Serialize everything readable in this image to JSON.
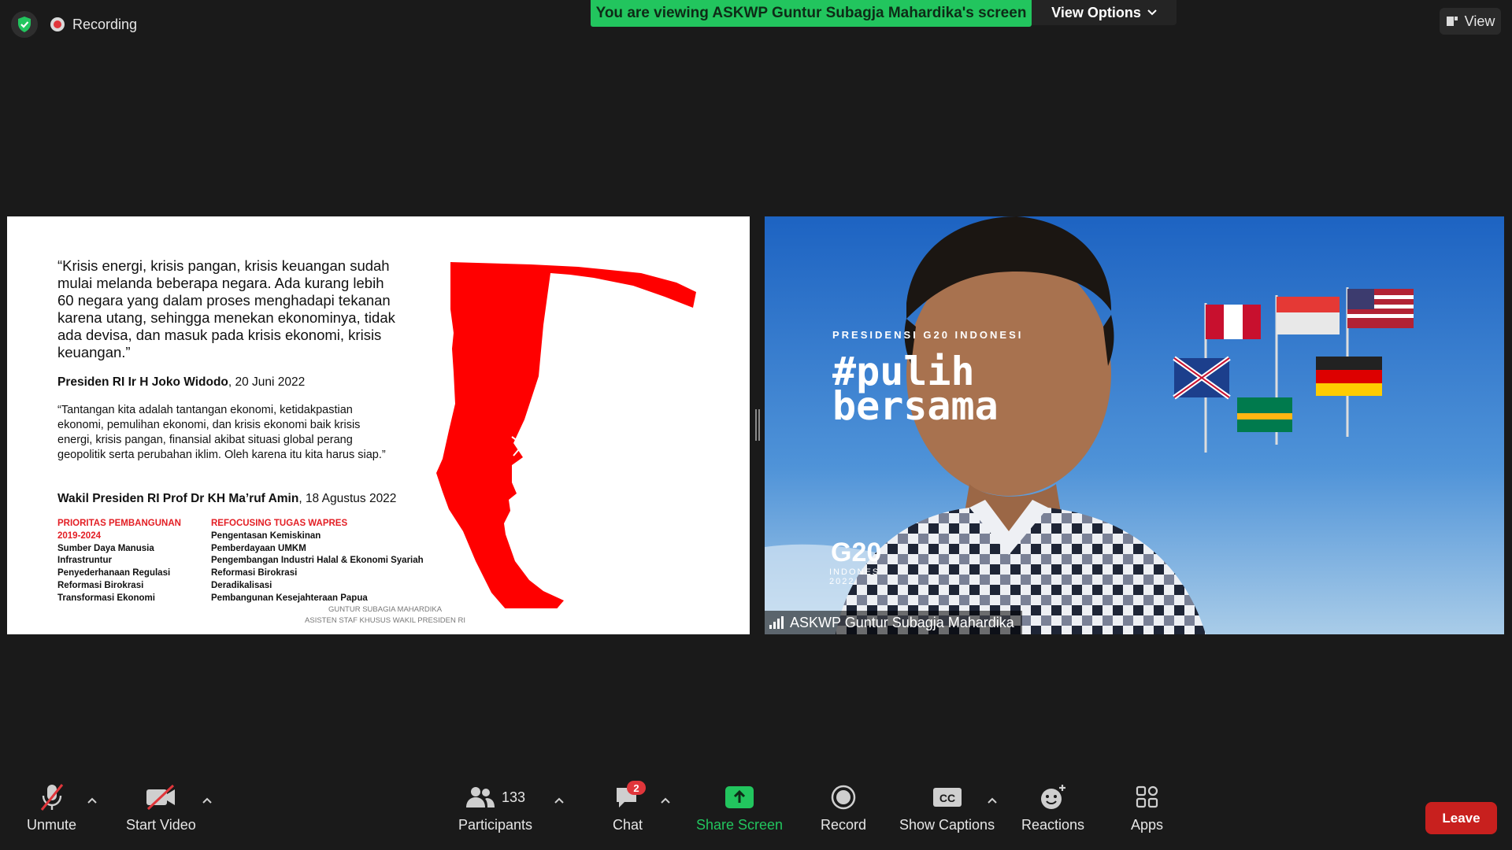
{
  "topbar": {
    "recording_label": "Recording",
    "viewing_banner": "You are viewing ASKWP Guntur Subagja Mahardika's screen",
    "view_options_label": "View Options",
    "view_label": "View",
    "shield_icon": "shield-check-icon"
  },
  "slide": {
    "quote1": "“Krisis energi, krisis pangan, krisis keuangan sudah mulai melanda beberapa negara. Ada kurang lebih 60 negara yang dalam proses menghadapi tekanan karena utang, sehingga menekan ekonominya, tidak ada devisa, dan masuk pada krisis ekonomi, krisis keuangan.”",
    "attr1_name": "Presiden RI Ir H Joko Widodo",
    "attr1_date": ", 20 Juni 2022",
    "quote2": "“Tantangan kita adalah tantangan ekonomi, ketidakpastian ekonomi, pemulihan ekonomi, dan krisis ekonomi baik krisis energi, krisis pangan, finansial akibat situasi global perang geopolitik serta perubahan iklim. Oleh karena itu kita harus siap.”",
    "attr2_name": "Wakil Presiden RI Prof Dr KH Ma’ruf Amin",
    "attr2_date": ", 18 Agustus 2022",
    "col1_head1": "PRIORITAS PEMBANGUNAN",
    "col1_head2": "2019-2024",
    "col1_items": [
      "Sumber Daya Manusia",
      "Infrastruntur",
      "Penyederhanaan Regulasi",
      "Reformasi Birokrasi",
      "Transformasi Ekonomi"
    ],
    "col2_head": "REFOCUSING TUGAS WAPRES",
    "col2_items": [
      "Pengentasan Kemiskinan",
      "Pemberdayaan UMKM",
      "Pengembangan Industri Halal & Ekonomi Syariah",
      "Reformasi Birokrasi",
      "Deradikalisasi",
      "Pembangunan Kesejahteraan Papua"
    ],
    "sig_line1": "GUNTUR SUBAGIA MAHARDIKA",
    "sig_line2": "ASISTEN STAF KHUSUS WAKIL PRESIDEN RI",
    "accent_color": "#e31e24"
  },
  "video": {
    "participant_name": "ASKWP Guntur Subagja Mahardika",
    "bg_pres": "PRESIDENSI G20 INDONESI",
    "bg_pulih_1": "#pulih",
    "bg_pulih_2": "bersama",
    "bg_g20": "G20",
    "bg_indo_1": "INDONES",
    "bg_indo_2": "2022"
  },
  "toolbar": {
    "unmute": "Unmute",
    "start_video": "Start Video",
    "participants": "Participants",
    "participants_count": "133",
    "chat": "Chat",
    "chat_badge": "2",
    "share_screen": "Share Screen",
    "record": "Record",
    "show_captions": "Show Captions",
    "reactions": "Reactions",
    "apps": "Apps",
    "leave": "Leave",
    "share_color": "#22c55e",
    "leave_color": "#c8201e"
  }
}
